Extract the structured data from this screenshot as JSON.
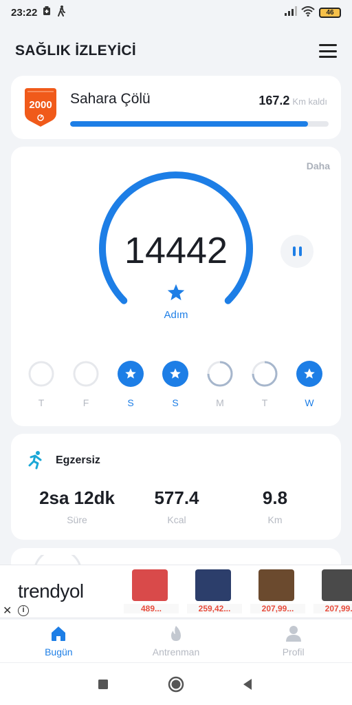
{
  "status_bar": {
    "time": "23:22",
    "battery": "46"
  },
  "header": {
    "title": "SAĞLIK İZLEYİCİ"
  },
  "goal": {
    "badge_number": "2000",
    "name": "Sahara Çölü",
    "remaining_value": "167.2",
    "remaining_unit": "Km kaldı",
    "progress": 0.92,
    "badge_color": "#f05a1a"
  },
  "steps": {
    "more_label": "Daha",
    "count": "14442",
    "label": "Adım",
    "accent": "#1d7ee6"
  },
  "week": {
    "days": [
      {
        "letter": "T",
        "state": "empty"
      },
      {
        "letter": "F",
        "state": "empty"
      },
      {
        "letter": "S",
        "state": "done"
      },
      {
        "letter": "S",
        "state": "done"
      },
      {
        "letter": "M",
        "state": "partial"
      },
      {
        "letter": "T",
        "state": "partial"
      },
      {
        "letter": "W",
        "state": "done"
      }
    ]
  },
  "exercise": {
    "title": "Egzersiz",
    "duration": {
      "value": "2sa 12dk",
      "label": "Süre"
    },
    "calories": {
      "value": "577.4",
      "label": "Kcal"
    },
    "distance": {
      "value": "9.8",
      "label": "Km"
    }
  },
  "ad": {
    "brand": "trendyol",
    "products": [
      {
        "price": "489...",
        "color": "#d94a4a"
      },
      {
        "price": "259,42...",
        "color": "#2c3e6b"
      },
      {
        "price": "207,99...",
        "color": "#6b4a2e"
      },
      {
        "price": "207,99...",
        "color": "#4a4a4a"
      }
    ]
  },
  "nav": {
    "items": [
      {
        "label": "Bugün",
        "icon": "home-icon"
      },
      {
        "label": "Antrenman",
        "icon": "flame-icon"
      },
      {
        "label": "Profil",
        "icon": "person-icon"
      }
    ]
  }
}
